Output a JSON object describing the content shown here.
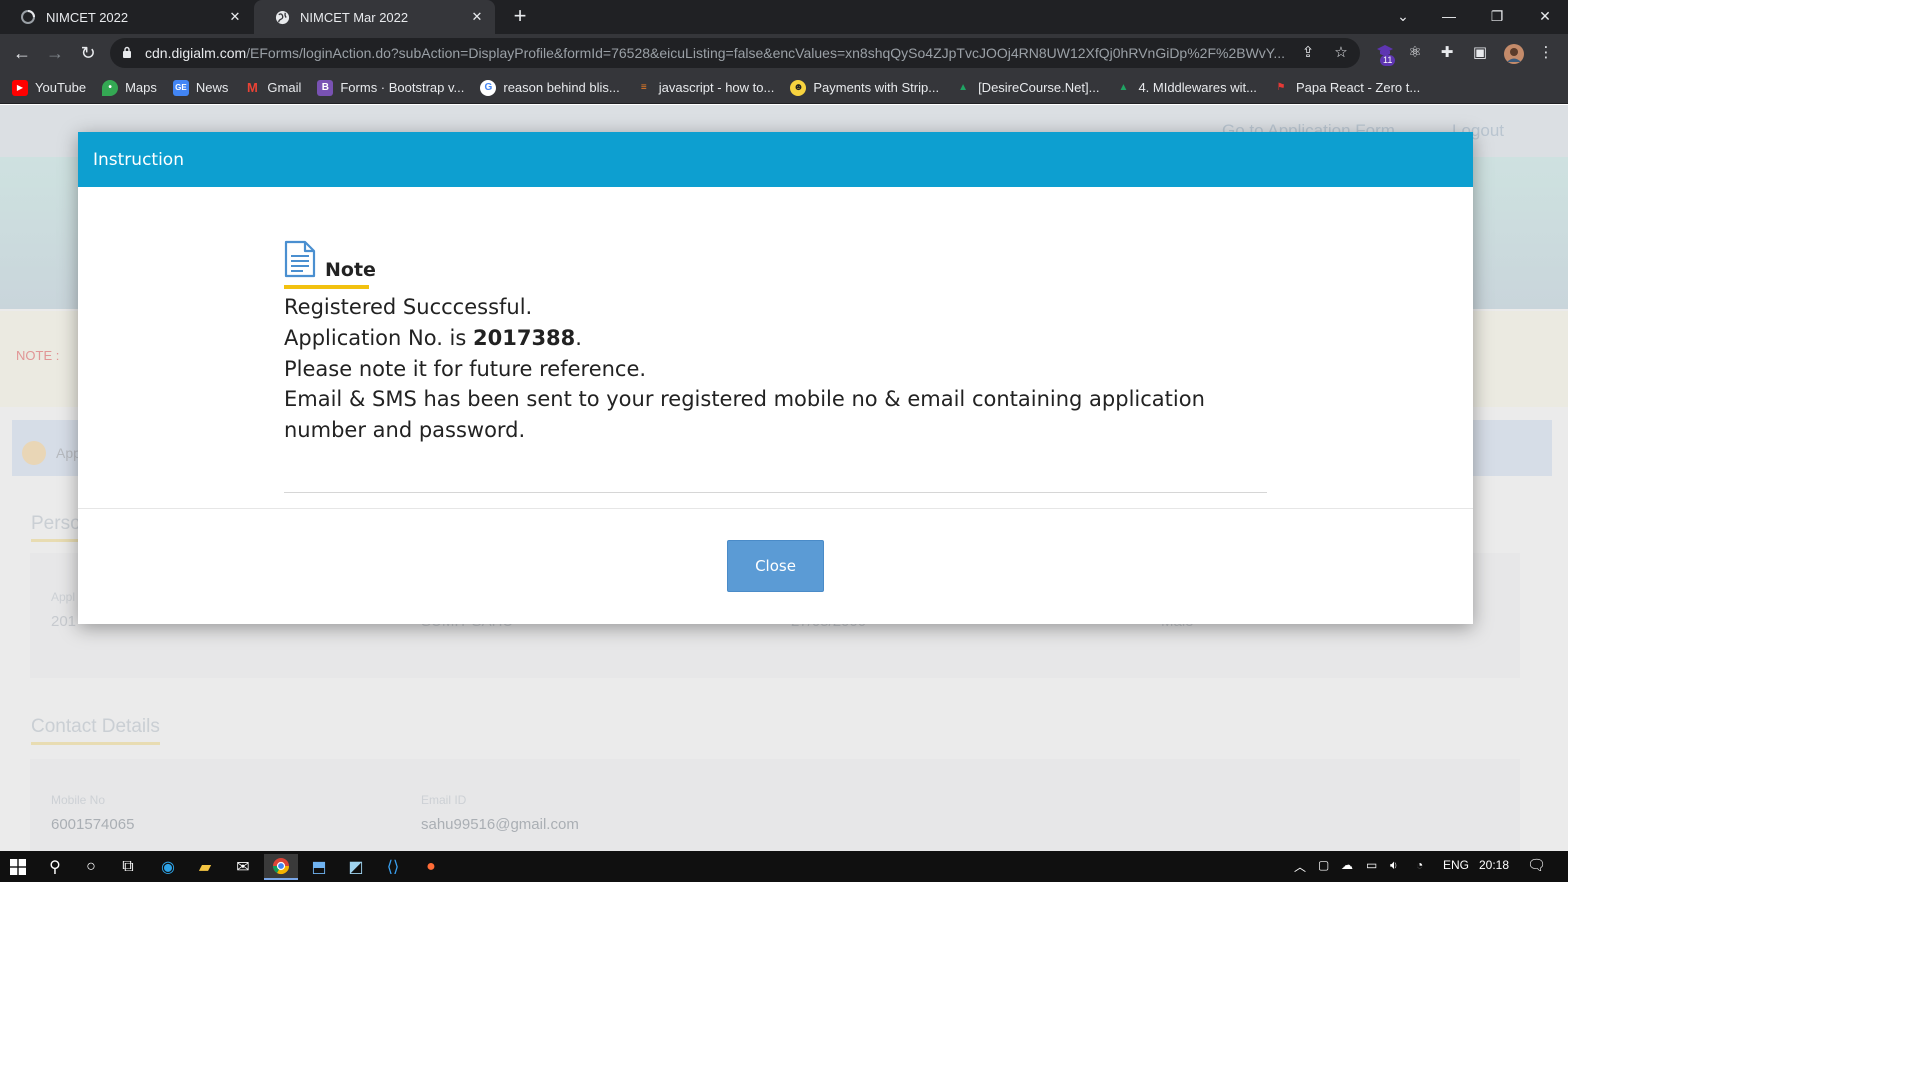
{
  "browser": {
    "tabs": [
      {
        "title": "NIMCET 2022",
        "icon": "spinner-icon"
      },
      {
        "title": "NIMCET Mar 2022",
        "icon": "globe-icon"
      }
    ],
    "url_host": "cdn.digialm.com",
    "url_path": "/EForms/loginAction.do?subAction=DisplayProfile&formId=76528&eicuListing=false&encValues=xn8shqQySo4ZJpTvcJOOj4RN8UW12XfQj0hRVnGiDp%2F%2BWvY...",
    "extension_badge": "11",
    "bookmarks": [
      {
        "label": "YouTube",
        "icon": "youtube-icon",
        "color": "#ff0000"
      },
      {
        "label": "Maps",
        "icon": "maps-icon",
        "color": "#34a853"
      },
      {
        "label": "News",
        "icon": "news-icon",
        "color": "#4285f4"
      },
      {
        "label": "Gmail",
        "icon": "gmail-icon",
        "color": "#ea4335"
      },
      {
        "label": "Forms · Bootstrap v...",
        "icon": "bootstrap-icon",
        "color": "#7952b3"
      },
      {
        "label": "reason behind blis...",
        "icon": "google-icon",
        "color": "#4285f4"
      },
      {
        "label": "javascript - how to...",
        "icon": "stackoverflow-icon",
        "color": "#f48024"
      },
      {
        "label": "Payments with Strip...",
        "icon": "stripe-icon",
        "color": "#f7d33f"
      },
      {
        "label": "[DesireCourse.Net]...",
        "icon": "drive-icon",
        "color": "#1fa463"
      },
      {
        "label": "4. MIddlewares wit...",
        "icon": "drive-icon",
        "color": "#1fa463"
      },
      {
        "label": "Papa React - Zero t...",
        "icon": "flag-icon",
        "color": "#e53935"
      }
    ]
  },
  "page": {
    "goto_label": "Go to Application Form",
    "logout_label": "Logout",
    "note_label": "NOTE :",
    "app_section": "App",
    "personal_section": "Perso",
    "personal_fields": [
      {
        "label": "Appl",
        "value": "201"
      },
      {
        "value": "SUMIT SAHU"
      },
      {
        "value": "27/05/2000"
      },
      {
        "value": "Male"
      }
    ],
    "contact_section": "Contact Details",
    "contact_fields": {
      "mobile_label": "Mobile No",
      "mobile_value": "6001574065",
      "email_label": "Email ID",
      "email_value": "sahu99516@gmail.com"
    }
  },
  "modal": {
    "title": "Instruction",
    "note_heading": "Note",
    "line1": "Registered Succcessful.",
    "line2_prefix": "Application No. is ",
    "application_no": "2017388",
    "line2_suffix": ".",
    "line3": "Please note it for future reference.",
    "line4": "Email & SMS has been sent to your registered mobile no & email containing application",
    "line5": "number and password.",
    "close_label": "Close"
  },
  "taskbar": {
    "language": "ENG",
    "time": "20:18"
  },
  "colors": {
    "modal_header": "#0d9fd0",
    "close_button": "#5b9bd5",
    "note_underline": "#f2c10f"
  }
}
